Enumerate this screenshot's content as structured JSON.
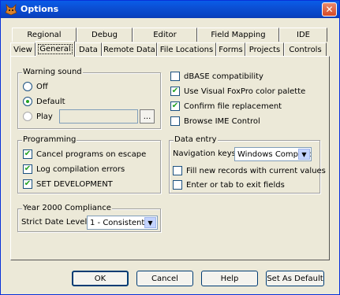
{
  "window": {
    "title": "Options",
    "close_icon": "close-icon"
  },
  "tabs_row_back": [
    "Regional",
    "Debug",
    "Editor",
    "Field Mapping",
    "IDE"
  ],
  "tabs_row_front": [
    "View",
    "General",
    "Data",
    "Remote Data",
    "File Locations",
    "Forms",
    "Projects",
    "Controls"
  ],
  "active_tab": "General",
  "warning_sound": {
    "label": "Warning sound",
    "options": [
      "Off",
      "Default",
      "Play"
    ],
    "selected": "Default",
    "browse_label": "..."
  },
  "programming": {
    "label": "Programming",
    "items": [
      {
        "label": "Cancel programs on escape",
        "checked": true
      },
      {
        "label": "Log compilation errors",
        "checked": true
      },
      {
        "label": "SET DEVELOPMENT",
        "checked": true
      }
    ]
  },
  "year2000": {
    "label": "Year 2000 Compliance",
    "strict_label": "Strict Date Level:",
    "strict_value": "1 - Consistent"
  },
  "right_options": [
    {
      "label": "dBASE compatibility",
      "checked": false
    },
    {
      "label": "Use Visual FoxPro color palette",
      "checked": true
    },
    {
      "label": "Confirm file replacement",
      "checked": true
    },
    {
      "label": "Browse IME Control",
      "checked": false
    }
  ],
  "data_entry": {
    "label": "Data entry",
    "nav_label": "Navigation keys:",
    "nav_value": "Windows Compatible",
    "items": [
      {
        "label": "Fill new records with current values",
        "checked": false
      },
      {
        "label": "Enter or tab to exit fields",
        "checked": false
      }
    ]
  },
  "buttons": {
    "ok": "OK",
    "cancel": "Cancel",
    "help": "Help",
    "set_default": "Set As Default"
  },
  "colors": {
    "title_bar": "#0b4fd4",
    "dialog_bg": "#ece9d8",
    "check_mark": "#21a121"
  }
}
